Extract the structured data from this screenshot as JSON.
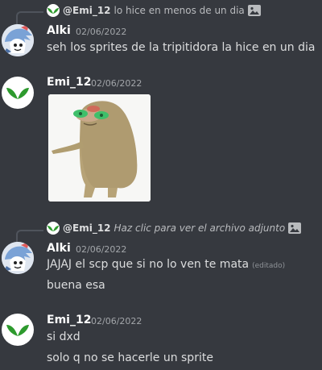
{
  "message_group_1": {
    "reply": {
      "author": "@Emi_12",
      "text": "lo hice en menos de un dia",
      "icon": "image-icon"
    },
    "author": "Alki",
    "timestamp": "02/06/2022",
    "text": "seh los sprites de la tripitidora la hice en un dia"
  },
  "message_group_2": {
    "author": "Emi_12",
    "timestamp": "02/06/2022",
    "attachment": "image-attachment"
  },
  "message_group_3": {
    "reply": {
      "author": "@Emi_12",
      "text": "Haz clic para ver el archivo adjunto",
      "icon": "image-icon"
    },
    "author": "Alki",
    "timestamp": "02/06/2022",
    "text": "JAJAJ el scp que si no lo ven te mata",
    "edited": "(editado)",
    "followup": "buena esa"
  },
  "message_group_4": {
    "author": "Emi_12",
    "timestamp": "02/06/2022",
    "text": "si dxd",
    "followup": "solo q no se hacerle un sprite"
  },
  "colors": {
    "background": "#36393f",
    "username": "#ffffff",
    "message_text": "#dcddde",
    "timestamp": "#a3a6aa",
    "leaf_green": "#2d9a2d"
  }
}
